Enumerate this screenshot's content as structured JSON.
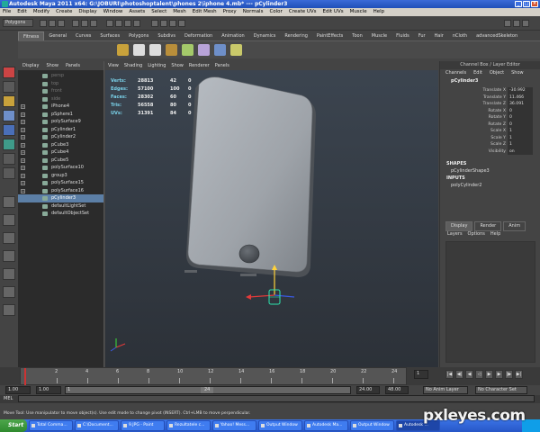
{
  "titlebar": {
    "title": "Autodesk Maya 2011 x64: G:\\JOBURI\\photoshoptalent\\phones 2\\iphone 4.mb*  ---  pCylinder3"
  },
  "menubar": [
    "File",
    "Edit",
    "Modify",
    "Create",
    "Display",
    "Window",
    "Assets",
    "Select",
    "Mesh",
    "Edit Mesh",
    "Proxy",
    "Normals",
    "Color",
    "Create UVs",
    "Edit UVs",
    "Muscle",
    "Help"
  ],
  "statusline": {
    "menuset": "Polygons"
  },
  "shelf": {
    "tabs": [
      "Curves",
      "Surfaces",
      "Polygons",
      "Subdivs",
      "Deformation",
      "Animation",
      "Dynamics",
      "Rendering",
      "PaintEffects",
      "Toon",
      "Muscle",
      "Fluids",
      "Fur",
      "Hair",
      "nCloth",
      "advancedSkeleton"
    ],
    "general_tab": "General",
    "first_tab": "Fitness"
  },
  "outliner": {
    "menu": [
      "Display",
      "Show",
      "Panels"
    ],
    "items": [
      {
        "label": "persp",
        "dim": true
      },
      {
        "label": "top",
        "dim": true
      },
      {
        "label": "front",
        "dim": true
      },
      {
        "label": "side",
        "dim": true
      },
      {
        "label": "iPhone4",
        "dim": false
      },
      {
        "label": "pSphere1",
        "dim": false
      },
      {
        "label": "polySurface9",
        "dim": false
      },
      {
        "label": "pCylinder1",
        "dim": false
      },
      {
        "label": "pCylinder2",
        "dim": false
      },
      {
        "label": "pCube3",
        "dim": false
      },
      {
        "label": "pCube4",
        "dim": false
      },
      {
        "label": "pCube5",
        "dim": false
      },
      {
        "label": "polySurface10",
        "dim": false
      },
      {
        "label": "group3",
        "dim": false
      },
      {
        "label": "polySurface15",
        "dim": false
      },
      {
        "label": "polySurface16",
        "dim": false
      },
      {
        "label": "pCylinder3",
        "dim": false,
        "selected": true
      },
      {
        "label": "defaultLightSet",
        "dim": false
      },
      {
        "label": "defaultObjectSet",
        "dim": false
      }
    ]
  },
  "viewport": {
    "menu": [
      "View",
      "Shading",
      "Lighting",
      "Show",
      "Renderer",
      "Panels"
    ],
    "hud": [
      {
        "label": "Verts:",
        "v1": "28813",
        "v2": "42",
        "v3": "0"
      },
      {
        "label": "Edges:",
        "v1": "57100",
        "v2": "100",
        "v3": "0"
      },
      {
        "label": "Faces:",
        "v1": "28302",
        "v2": "60",
        "v3": "0"
      },
      {
        "label": "Tris:",
        "v1": "56558",
        "v2": "80",
        "v3": "0"
      },
      {
        "label": "UVs:",
        "v1": "31391",
        "v2": "84",
        "v3": "0"
      }
    ]
  },
  "channelbox": {
    "title": "Channel Box / Layer Editor",
    "menu": [
      "Channels",
      "Edit",
      "Object",
      "Show"
    ],
    "node": "pCylinder3",
    "attrs": [
      {
        "name": "Translate X",
        "value": "-30.992"
      },
      {
        "name": "Translate Y",
        "value": "11.466"
      },
      {
        "name": "Translate Z",
        "value": "36.091"
      },
      {
        "name": "Rotate X",
        "value": "0"
      },
      {
        "name": "Rotate Y",
        "value": "0"
      },
      {
        "name": "Rotate Z",
        "value": "0"
      },
      {
        "name": "Scale X",
        "value": "1"
      },
      {
        "name": "Scale Y",
        "value": "1"
      },
      {
        "name": "Scale Z",
        "value": "1"
      },
      {
        "name": "Visibility",
        "value": "on"
      }
    ],
    "shapes_label": "SHAPES",
    "shape_node": "pCylinderShape3",
    "inputs_label": "INPUTS",
    "input_node": "polyCylinder2",
    "layer_tabs": [
      "Display",
      "Render",
      "Anim"
    ],
    "layer_menu": [
      "Layers",
      "Options",
      "Help"
    ]
  },
  "timeslider": {
    "ticks": [
      "2",
      "4",
      "6",
      "8",
      "10",
      "12",
      "14",
      "16",
      "18",
      "20",
      "22",
      "24"
    ],
    "current_frame": "1"
  },
  "rangeslider": {
    "start": "1.00",
    "start_inner": "1.00",
    "start_marker": "1",
    "end_marker": "24",
    "end_inner": "24.00",
    "end": "48.00",
    "anim_layer": "No Anim Layer",
    "char_set": "No Character Set"
  },
  "cmdline": {
    "label": "MEL"
  },
  "helpline": {
    "text": "Move Tool: Use manipulator to move object(s). Use edit mode to change pivot (INSERT). Ctrl+LMB to move perpendicular."
  },
  "taskbar": {
    "start": "Start",
    "buttons": [
      {
        "label": "Total Comma...",
        "active": false
      },
      {
        "label": "C:\\Document...",
        "active": false
      },
      {
        "label": "9.JPG - Paint",
        "active": false
      },
      {
        "label": "Rezultatele c...",
        "active": false
      },
      {
        "label": "Yahoo! Mess...",
        "active": false
      },
      {
        "label": "Output Window",
        "active": false
      },
      {
        "label": "Autodesk Ma...",
        "active": false
      },
      {
        "label": "Output Window",
        "active": false
      },
      {
        "label": "Autodesk ...",
        "active": true
      }
    ]
  },
  "watermark": "pxleyes.com"
}
